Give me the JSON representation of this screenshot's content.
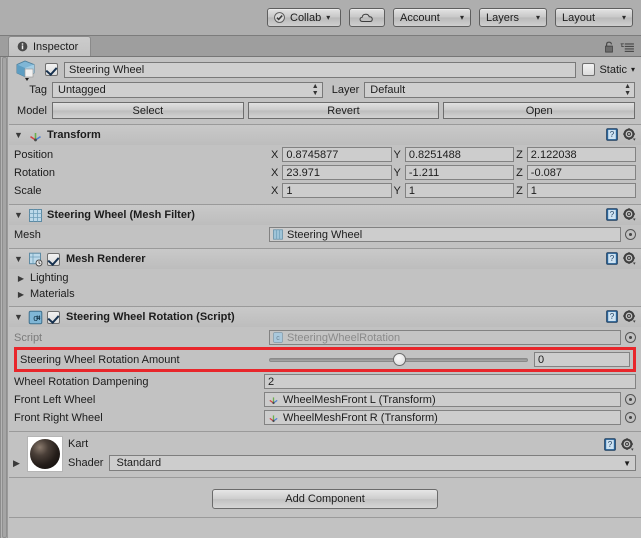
{
  "toolbar": {
    "collab_label": "Collab",
    "collab_icon": "check-circle-icon",
    "cloud_icon": "cloud-icon",
    "account_label": "Account",
    "layers_label": "Layers",
    "layout_label": "Layout",
    "caret": "▾"
  },
  "tabbar": {
    "tab_label": "Inspector",
    "tab_icon": "info-icon",
    "lock_icon": "lock-icon",
    "menu_icon": "hamburger-menu-icon"
  },
  "object_header": {
    "icon": "prefab-cube-icon",
    "enabled": true,
    "name": "Steering Wheel",
    "static_label": "Static",
    "static_checked": false,
    "tag_label": "Tag",
    "tag_value": "Untagged",
    "layer_label": "Layer",
    "layer_value": "Default",
    "model_label": "Model",
    "model_buttons": [
      "Select",
      "Revert",
      "Open"
    ]
  },
  "components": [
    {
      "id": "transform",
      "icon": "transform-axis-icon",
      "title": "Transform",
      "expanded": true,
      "rows": [
        {
          "label": "Position",
          "x": "0.8745877",
          "y": "0.8251488",
          "z": "2.122038"
        },
        {
          "label": "Rotation",
          "x": "23.971",
          "y": "-1.211",
          "z": "-0.087"
        },
        {
          "label": "Scale",
          "x": "1",
          "y": "1",
          "z": "1"
        }
      ],
      "axis_labels": [
        "X",
        "Y",
        "Z"
      ]
    },
    {
      "id": "mesh-filter",
      "icon": "mesh-filter-icon",
      "title": "Steering Wheel (Mesh Filter)",
      "expanded": true,
      "mesh_label": "Mesh",
      "mesh_value": "Steering Wheel",
      "mesh_value_icon": "mesh-icon"
    },
    {
      "id": "mesh-renderer",
      "icon": "mesh-renderer-icon",
      "title": "Mesh Renderer",
      "enabled": true,
      "expanded": true,
      "foldouts": [
        "Lighting",
        "Materials"
      ]
    },
    {
      "id": "steering-wheel-rotation",
      "icon": "csharp-script-icon",
      "title": "Steering Wheel Rotation (Script)",
      "enabled": true,
      "expanded": true,
      "script_label": "Script",
      "script_value": "SteeringWheelRotation",
      "script_value_icon": "script-icon",
      "slider_row": {
        "label": "Steering Wheel Rotation Amount",
        "value": "0",
        "knob_percent": 50,
        "highlighted": true,
        "highlight_color": "#e8262b"
      },
      "fields": [
        {
          "label": "Wheel Rotation Dampening",
          "value": "2",
          "kind": "text"
        },
        {
          "label": "Front Left Wheel",
          "value": "WheelMeshFront L (Transform)",
          "kind": "object",
          "icon": "transform-axis-icon"
        },
        {
          "label": "Front Right Wheel",
          "value": "WheelMeshFront R (Transform)",
          "kind": "object",
          "icon": "transform-axis-icon"
        }
      ]
    }
  ],
  "material": {
    "thumbnail_icon": "material-sphere-preview",
    "name": "Kart",
    "shader_label": "Shader",
    "shader_value": "Standard",
    "help_icon": "help-book-icon",
    "gear_icon": "gear-icon"
  },
  "add_component_label": "Add Component"
}
